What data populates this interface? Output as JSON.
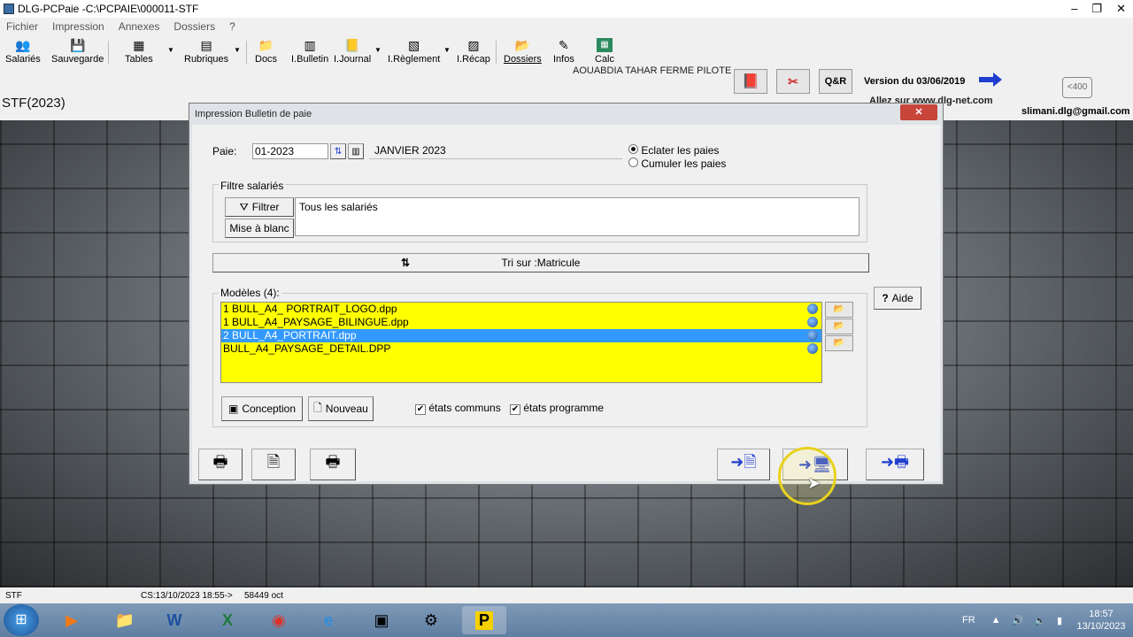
{
  "window": {
    "title": "DLG-PCPaie -C:\\PCPAIE\\000011-STF",
    "controls": [
      "–",
      "❐",
      "✕"
    ]
  },
  "menu": [
    "Fichier",
    "Impression",
    "Annexes",
    "Dossiers",
    "?"
  ],
  "toolbar": {
    "items": [
      {
        "label": "Salariés",
        "icon": "users-icon"
      },
      {
        "label": "Sauvegarde",
        "icon": "save-icon"
      },
      {
        "label": "Tables",
        "icon": "tables-icon"
      },
      {
        "label": "Rubriques",
        "icon": "rubriques-icon"
      },
      {
        "label": "Docs",
        "icon": "folder-icon"
      },
      {
        "label": "I.Bulletin",
        "icon": "bulletin-icon"
      },
      {
        "label": "I.Journal",
        "icon": "journal-icon"
      },
      {
        "label": "I.Règlement",
        "icon": "reglement-icon"
      },
      {
        "label": "I.Récap",
        "icon": "recap-icon"
      },
      {
        "label": "Dossiers",
        "icon": "folder-open-icon"
      },
      {
        "label": "Infos",
        "icon": "info-icon"
      },
      {
        "label": "Calc",
        "icon": "calculator-icon"
      }
    ],
    "company": "AOUABDIA TAHAR FERME PILOTE",
    "qr_label": "Q&R",
    "version": "Version du 03/06/2019",
    "site": "Allez sur www.dlg-net.com",
    "email": "slimani.dlg@gmail.com",
    "badge": "<400"
  },
  "screen_title": "STF(2023)",
  "dialog": {
    "title": "Impression Bulletin de paie",
    "close": "✕",
    "paie_label": "Paie:",
    "paie_value": "01-2023",
    "paie_month": "JANVIER 2023",
    "radio_eclater": "Eclater les paies",
    "radio_cumuler": "Cumuler les paies",
    "filtre_group": "Filtre salariés",
    "filtrer_button": "Filtrer",
    "mise_blanc_button": "Mise à blanc",
    "filtre_text": "Tous les salariés",
    "tri_text": "Tri sur :Matricule",
    "modeles_group": "Modèles (4):",
    "aide_button": "Aide",
    "models": [
      "1 BULL_A4_ PORTRAIT_LOGO.dpp",
      "1 BULL_A4_PAYSAGE_BILINGUE.dpp",
      "2 BULL_A4_PORTRAIT.dpp",
      "BULL_A4_PAYSAGE_DETAIL.DPP"
    ],
    "selected_model_index": 2,
    "conception_button": "Conception",
    "nouveau_button": "Nouveau",
    "etats_communs": "états communs",
    "etats_programme": "états programme"
  },
  "statusbar": {
    "left": "STF",
    "cs": "CS:13/10/2023 18:55->",
    "size": "58449 oct"
  },
  "taskbar": {
    "lang": "FR",
    "time": "18:57",
    "date": "13/10/2023"
  }
}
